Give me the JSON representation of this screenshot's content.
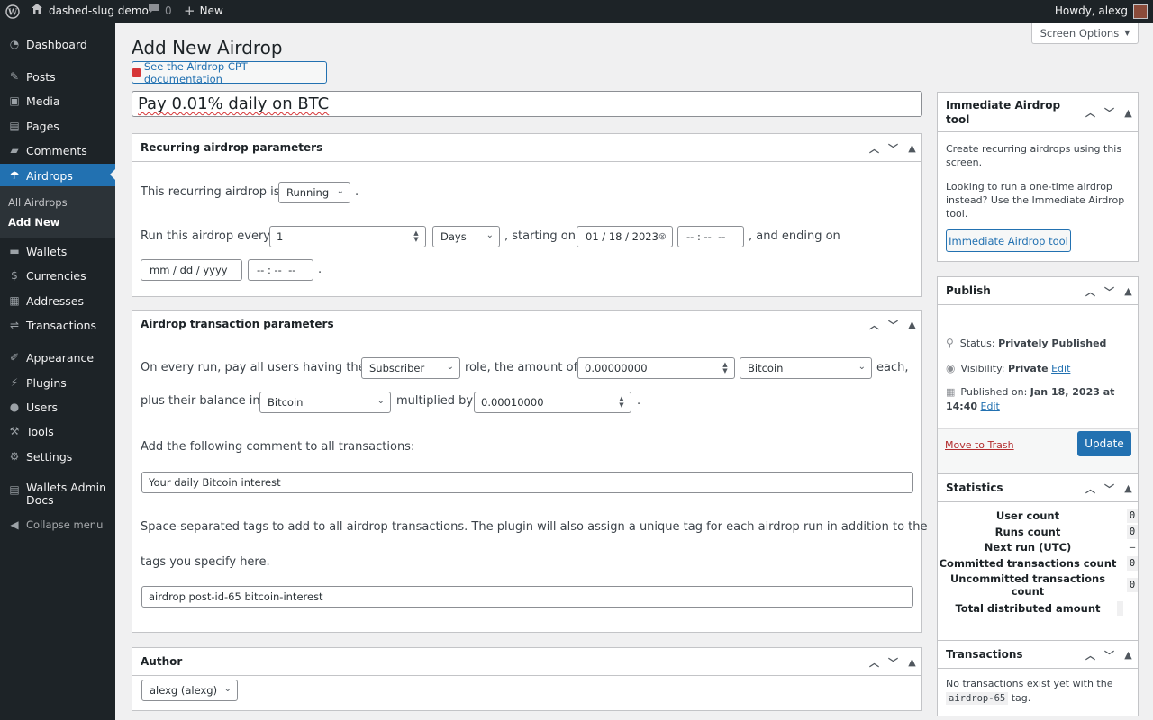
{
  "adminbar": {
    "site_name": "dashed-slug demo",
    "comments_count": "0",
    "new_label": "New",
    "howdy": "Howdy, alexg"
  },
  "sidebar": {
    "items": [
      {
        "label": "Dashboard",
        "icon": "dashboard-icon"
      },
      {
        "label": "Posts",
        "icon": "pin-icon"
      },
      {
        "label": "Media",
        "icon": "media-icon"
      },
      {
        "label": "Pages",
        "icon": "pages-icon"
      },
      {
        "label": "Comments",
        "icon": "comment-icon"
      },
      {
        "label": "Airdrops",
        "icon": "parachute-icon"
      },
      {
        "label": "Wallets",
        "icon": "wallet-icon"
      },
      {
        "label": "Currencies",
        "icon": "currency-icon"
      },
      {
        "label": "Addresses",
        "icon": "address-icon"
      },
      {
        "label": "Transactions",
        "icon": "transactions-icon"
      },
      {
        "label": "Appearance",
        "icon": "brush-icon"
      },
      {
        "label": "Plugins",
        "icon": "plugin-icon"
      },
      {
        "label": "Users",
        "icon": "users-icon"
      },
      {
        "label": "Tools",
        "icon": "wrench-icon"
      },
      {
        "label": "Settings",
        "icon": "settings-icon"
      },
      {
        "label": "Wallets Admin Docs",
        "icon": "docs-icon"
      }
    ],
    "submenu": [
      "All Airdrops",
      "Add New"
    ],
    "collapse": "Collapse menu"
  },
  "page": {
    "title": "Add New Airdrop",
    "screen_options": "Screen Options",
    "doc_button": "See the Airdrop CPT documentation",
    "post_title": "Pay 0.01% daily on BTC"
  },
  "recurring": {
    "header": "Recurring airdrop parameters",
    "status_prefix": "This recurring airdrop is",
    "status_value": "Running",
    "period_suffix": ".",
    "run_every": "Run this airdrop every",
    "interval": "1",
    "unit": "Days",
    "starting_on": ", starting on",
    "start_date": "01 / 18 / 2023",
    "start_time": "-- : --  --",
    "ending_on": ", and ending on",
    "end_date": "mm / dd / yyyy",
    "end_time": "-- : --  --",
    "end_period": "."
  },
  "transaction": {
    "header": "Airdrop transaction parameters",
    "on_every_run": "On every run, pay all users having the",
    "role": "Subscriber",
    "role_amount": "role, the amount of",
    "amount": "0.00000000",
    "currency": "Bitcoin",
    "each": "each,",
    "plus_balance": "plus their balance in",
    "balance_currency": "Bitcoin",
    "multiplied_by": "multiplied by",
    "multiplier": "0.00010000",
    "mult_period": ".",
    "comment_label": "Add the following comment to all transactions:",
    "comment_value": "Your daily Bitcoin interest",
    "tags_label_1": "Space-separated tags to add to all airdrop transactions. The plugin will also assign a unique tag for each airdrop run in addition to the",
    "tags_label_2": "tags you specify here.",
    "tags_value": "airdrop post-id-65 bitcoin-interest"
  },
  "author": {
    "header": "Author",
    "value": "alexg (alexg)"
  },
  "immediate": {
    "header": "Immediate Airdrop tool",
    "text1": "Create recurring airdrops using this screen.",
    "text2": "Looking to run a one-time airdrop instead? Use the Immediate Airdrop tool.",
    "button": "Immediate Airdrop tool"
  },
  "publish": {
    "header": "Publish",
    "status_label": "Status:",
    "status_value": "Privately Published",
    "visibility_label": "Visibility:",
    "visibility_value": "Private",
    "edit": "Edit",
    "published_label": "Published on:",
    "published_value_1": "Jan 18, 2023 at",
    "published_value_2": "14:40",
    "trash": "Move to Trash",
    "update": "Update"
  },
  "statistics": {
    "header": "Statistics",
    "rows": [
      {
        "label": "User count",
        "value": "0"
      },
      {
        "label": "Runs count",
        "value": "0"
      },
      {
        "label": "Next run (UTC)",
        "value": "—"
      },
      {
        "label": "Committed transactions count",
        "value": "0"
      },
      {
        "label": "Uncommitted transactions count",
        "value": "0"
      },
      {
        "label": "Total distributed amount",
        "value": ""
      }
    ]
  },
  "transactions_box": {
    "header": "Transactions",
    "text": "No transactions exist yet with the",
    "tag": "airdrop-65",
    "text_end": "tag."
  },
  "colors": {
    "accent": "#2271b1",
    "sidebar_bg": "#1d2327",
    "page_bg": "#f0f0f1"
  }
}
